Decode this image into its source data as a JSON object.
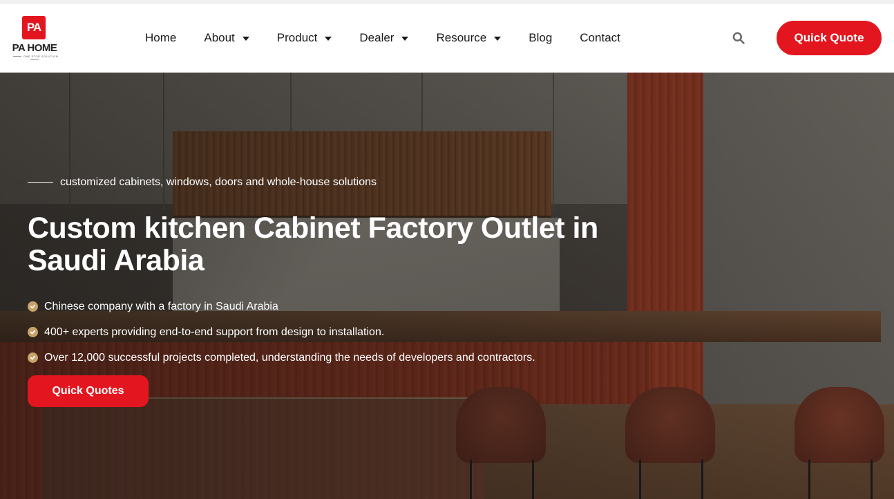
{
  "brand": {
    "badge": "PA",
    "name": "PA HOME",
    "tagline": "ONE STOP SOLUTION",
    "color": "#e3161f"
  },
  "nav": {
    "items": [
      {
        "label": "Home",
        "has_dropdown": false
      },
      {
        "label": "About",
        "has_dropdown": true
      },
      {
        "label": "Product",
        "has_dropdown": true
      },
      {
        "label": "Dealer",
        "has_dropdown": true
      },
      {
        "label": "Resource",
        "has_dropdown": true
      },
      {
        "label": "Blog",
        "has_dropdown": false
      },
      {
        "label": "Contact",
        "has_dropdown": false
      }
    ],
    "search_icon": "search-icon",
    "quote_button": "Quick Quote"
  },
  "hero": {
    "eyebrow": "customized cabinets, windows, doors and whole-house solutions",
    "title": "Custom kitchen Cabinet Factory Outlet in Saudi Arabia",
    "bullets": [
      "Chinese company with a factory in Saudi Arabia",
      "400+ experts providing end-to-end support from design to installation.",
      "Over 12,000 successful projects completed, understanding the needs of developers and contractors."
    ],
    "bullet_icon": "check-circle-icon",
    "bullet_icon_color": "#c9a26a",
    "cta": "Quick Quotes"
  }
}
